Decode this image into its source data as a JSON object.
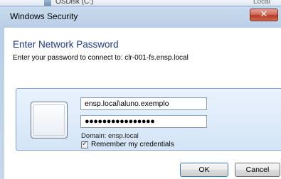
{
  "background_window": {
    "drive_label": "OSDisk (C:)",
    "right_fragment": "Local"
  },
  "dialog": {
    "title": "Windows Security",
    "close_glyph": "✕",
    "heading": "Enter Network Password",
    "instructions": "Enter your password to connect to: clr-001-fs.ensp.local",
    "username_value": "ensp.local\\aluno.exemplo",
    "password_masked": "●●●●●●●●●●●●●●●●",
    "domain_text": "Domain: ensp.local",
    "remember_label": "Remember my credentials",
    "remember_checked": true,
    "ok_label": "OK",
    "cancel_label": "Cancel"
  },
  "colors": {
    "heading": "#1e3a8a",
    "close_button": "#c2402a",
    "tile_border": "#7da2ce"
  },
  "icons": {
    "close": "close-icon",
    "user": "user-tile-icon",
    "drive": "drive-icon",
    "check": "checkmark-icon"
  }
}
